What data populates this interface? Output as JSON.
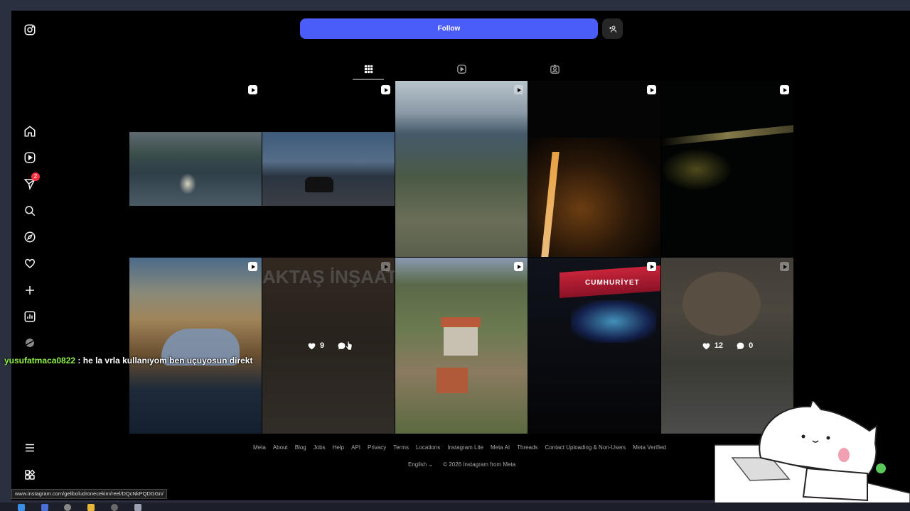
{
  "header": {
    "follow_label": "Follow",
    "adduser_icon": "add-user-icon"
  },
  "tabs": [
    {
      "name": "posts",
      "icon": "grid-icon",
      "active": true
    },
    {
      "name": "reels",
      "icon": "reels-icon",
      "active": false
    },
    {
      "name": "tagged",
      "icon": "tagged-icon",
      "active": false
    }
  ],
  "sidebar": {
    "items": [
      {
        "icon": "instagram-logo-icon"
      },
      {
        "icon": "home-icon"
      },
      {
        "icon": "reels-icon"
      },
      {
        "icon": "messages-icon",
        "badge": "2"
      },
      {
        "icon": "search-icon"
      },
      {
        "icon": "explore-icon"
      },
      {
        "icon": "heart-icon"
      },
      {
        "icon": "create-icon"
      },
      {
        "icon": "dashboard-icon"
      },
      {
        "icon": "profile-avatar"
      },
      {
        "icon": "menu-icon"
      },
      {
        "icon": "also-from-meta-icon"
      }
    ]
  },
  "grid": {
    "tile_6_overlay_text": "AKTAŞ İNŞAAT",
    "hover_tiles": [
      {
        "likes": "9",
        "comments": ""
      },
      {
        "likes": "12",
        "comments": "0"
      }
    ],
    "tile_9_text": "CUMHURİYET"
  },
  "footer": {
    "links": [
      "Meta",
      "About",
      "Blog",
      "Jobs",
      "Help",
      "API",
      "Privacy",
      "Terms",
      "Locations",
      "Instagram Lite",
      "Meta AI",
      "Threads",
      "Contact Uploading & Non-Users",
      "Meta Verified"
    ],
    "language": "English",
    "copyright": "© 2026 Instagram from Meta"
  },
  "chat": {
    "username": "yusufatmaca0822",
    "message": ": he la vrla kullanıyom ben uçuyosun direkt"
  },
  "status_url": "www.instagram.com/geliboludronecekim/reel/DQcNkPQDGGn/",
  "colors": {
    "follow": "#4a5df9",
    "badge": "#ff3040",
    "chat_user": "#8ef248"
  }
}
